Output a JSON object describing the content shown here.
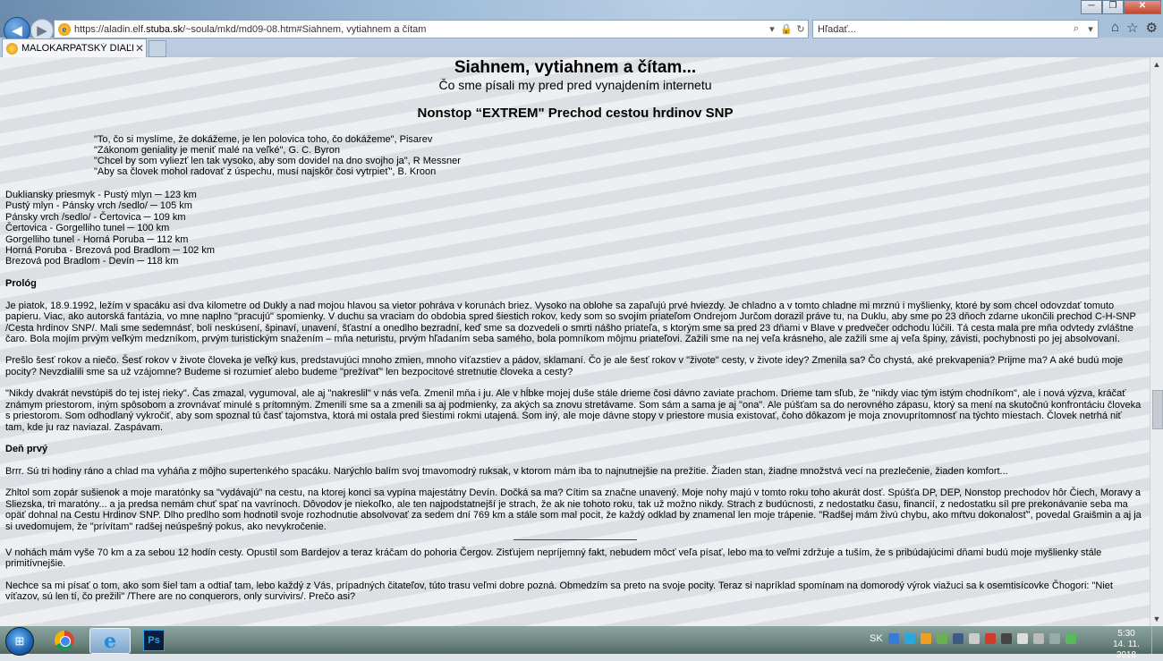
{
  "browser": {
    "url_prefix": "https://aladin.elf.",
    "url_domain": "stuba.sk",
    "url_rest": "/~soula/mkd/md09-08.htm#Siahnem, vytiahnem a čítam",
    "search_placeholder": "Hľadať...",
    "tab_title": "MALOKARPATSKÝ DIAĽKO...",
    "back_icon": "back-arrow-icon",
    "forward_icon": "forward-arrow-icon"
  },
  "page": {
    "title": "Siahnem, vytiahnem a čítam...",
    "subtitle": "Čo sme písali my pred pred vynajdením internetu",
    "heading": "Nonstop “EXTREM\" Prechod cestou hrdinov SNP",
    "quotes": [
      "\"To, čo si myslíme, že dokážeme, je len polovica toho, čo dokážeme\", Pisarev",
      "\"Zákonom geniality je meniť malé na veľké\", G. C. Byron",
      "\"Chcel by som vyliezť len tak vysoko, aby som dovidel na dno svojho ja\", R Messner",
      "\"Aby sa človek mohol radovať z úspechu, musí najskôr čosi vytrpieť\", B. Kroon"
    ],
    "routes": [
      "Dukliansky priesmyk - Pustý mlyn ─ 123 km",
      "Pustý mlyn - Pánsky vrch /sedlo/ ─ 105 km",
      "Pánsky vrch /sedlo/ - Čertovica ─ 109 km",
      "Čertovica - Gorgelliho tunel ─ 100 km",
      "Gorgelliho tunel - Horná Poruba ─ 112 km",
      "Horná Poruba - Brezová pod Bradlom ─ 102 km",
      "Brezová pod Bradlom - Devín ─ 118 km"
    ],
    "prolog_heading": "Prológ",
    "p1": "Je piatok, 18.9.1992, ležím v spacáku asi dva kilometre od Dukly a nad mojou hlavou sa vietor pohráva v korunách briez. Vysoko na oblohe sa zapaľujú prvé hviezdy. Je chladno a v tomto chladne mi mrznú i myšlienky, ktoré by som chcel odovzdať tomuto papieru. Viac, ako autorská fantázia, vo mne naplno \"pracujú\" spomienky. V duchu sa vraciam do obdobia spred šiestich rokov, kedy som so svojím priateľom Ondrejom Jurčom dorazil práve tu, na Duklu, aby sme po 23 dňoch zdarne ukončili prechod C-H-SNP /Cesta hrdinov SNP/. Mali sme sedemnásť, boli neskúsení, špinaví, unavení, šťastní a onedlho bezradní, keď sme sa dozvedeli o smrti nášho priateľa, s ktorým sme sa pred 23 dňami v Blave v predvečer odchodu lúčili. Tá cesta mala pre mňa odvtedy zvláštne čaro. Bola mojím prvým veľkým medzníkom, prvým turistickým snažením – mňa neturistu, prvým hľadaním seba samého, bola pomníkom môjmu priateľovi. Zažili sme na nej veľa krásneho, ale zažili sme aj veľa špiny, závisti, pochybnosti po jej absolvovaní.",
    "p2": "Prešlo šesť rokov a niečo. Šesť rokov v živote človeka je veľký kus, predstavujúci mnoho zmien, mnoho víťazstiev a pádov, sklamaní. Čo je ale šesť rokov v \"živote\" cesty, v živote idey? Zmenila sa? Čo chystá, aké prekvapenia? Prijme ma? A aké budú moje pocity? Nevzdialili sme sa už vzájomne? Budeme si rozumieť alebo budeme \"prežívať\" len bezpocitové stretnutie človeka a cesty?",
    "p3": "\"Nikdy dvakrát nevstúpiš do tej istej rieky\". Čas zmazal, vygumoval, ale aj \"nakreslil\" v nás veľa. Zmenil mňa i ju. Ale v hĺbke mojej duše stále drieme čosi dávno zaviate prachom. Drieme tam sľub, že \"nikdy viac tým istým chodníkom\", ale i nová výzva, kráčať známym priestorom, iným spôsobom a zrovnávať minulé s prítomným. Zmenili sme sa a zmenili sa aj podmienky, za akých sa znovu stretávame. Som sám a sama je aj \"ona\". Ale púšťam sa do nerovného zápasu, ktorý sa mení na skutočnú konfrontáciu človeka s priestorom. Som odhodlaný vykročiť, aby som spoznal tú časť tajomstva, ktorá mi ostala pred šiestimi rokmi utajená. Som iný, ale moje dávne stopy v priestore musia existovať, čoho dôkazom je moja znovuprítomnosť na týchto miestach. Človek netrhá niť tam, kde ju raz naviazal. Zaspávam.",
    "day1_heading": "Deň prvý",
    "p4": "Brrr. Sú tri hodiny ráno a chlad ma vyháňa z môjho supertenkého spacáku. Narýchlo balím svoj tmavomodrý ruksak, v ktorom mám iba to najnutnejšie na prežitie. Žiaden stan, žiadne množstvá vecí na prezlečenie, žiaden komfort...",
    "p5": "Zhltol som zopár sušienok a moje maratónky sa \"vydávajú\" na cestu, na ktorej konci sa vypína majestátny Devín. Dočká sa ma? Cítim sa značne unavený. Moje nohy majú v tomto roku toho akurát dosť. Spúšťa DP, DEP, Nonstop prechodov hôr Čiech, Moravy a Sliezska, tri maratóny... a ja predsa nemám chuť spať na vavrínoch. Dôvodov je niekoľko, ale ten najpodstatnejší je strach, že ak nie tohoto roku, tak už možno nikdy. Strach z budúcnosti, z nedostatku času, financií, z nedostatku síl pre prekonávanie seba ma opäť dohnal na Cestu Hrdinov SNP. Dlho predlho som hodnotil svoje rozhodnutie absolvovať za sedem dní 769 km a stále som mal pocit, že každý odklad by znamenal len moje trápenie. \"Radšej mám živú chybu, ako mŕtvu dokonalosť\", povedal Graišmin a aj ja si uvedomujem, že \"prívítam\" radšej neúspešný pokus, ako nevykročenie.",
    "p6": "V nohách mám vyše 70 km a za sebou 12 hodín cesty. Opustil som Bardejov a teraz kráčam do pohoria Čergov. Zisťujem nepríjemný fakt, nebudem môcť veľa písať, lebo ma to veľmi zdržuje a tuším, že s pribúdajúcimi dňami budú moje myšlienky stále primitívnejšie.",
    "p7": "Nechce sa mi písať o tom, ako som šiel tam a odtiaľ tam, lebo každý z Vás, prípadných čitateľov, túto trasu veľmi dobre pozná. Obmedzím sa preto na svoje pocity. Teraz si napríklad spomínam na domorodý výrok viažuci sa k osemtisícovke Čhogori: \"Niet víťazov, sú len tí, čo prežili\" /There are no conquerors, only survivirs/. Prečo asi?"
  },
  "taskbar": {
    "lang": "SK",
    "time": "5:30",
    "date": "14. 11. 2018",
    "apps": [
      "chrome-icon",
      "internet-explorer-icon",
      "photoshop-icon"
    ],
    "ps_label": "Ps"
  }
}
